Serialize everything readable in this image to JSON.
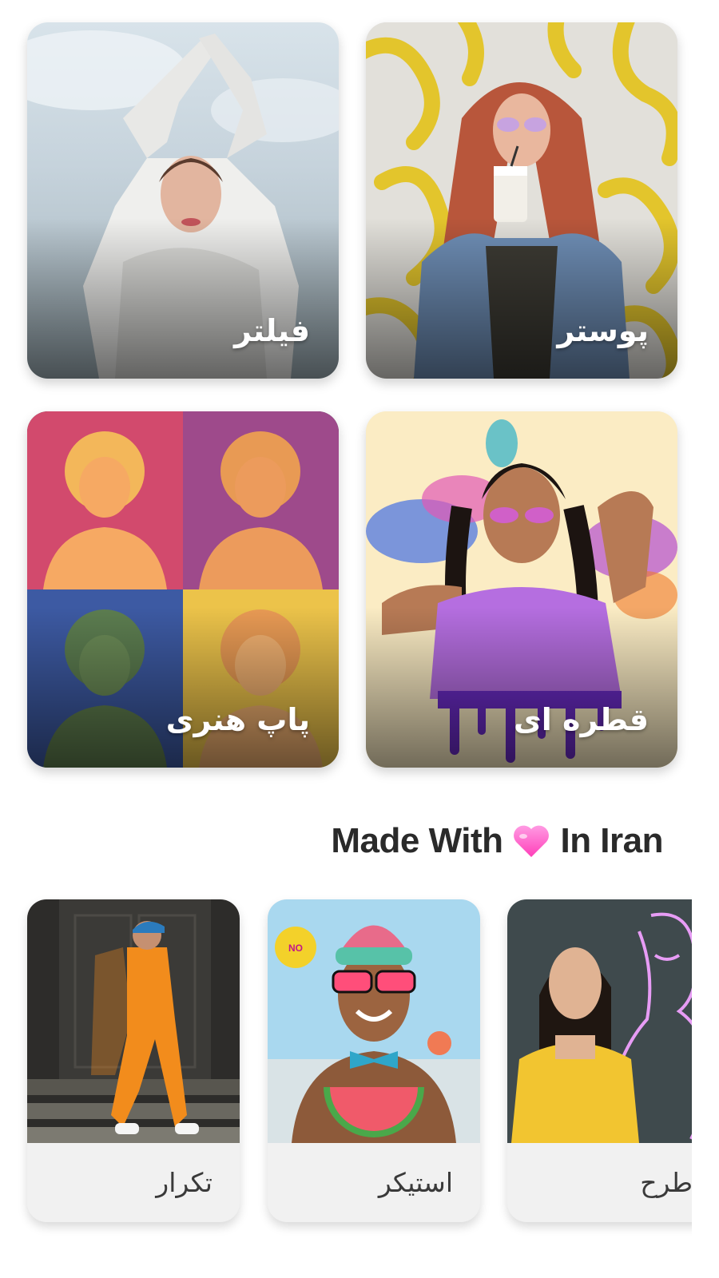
{
  "feature_cards": [
    {
      "label": "فیلتر"
    },
    {
      "label": "پوستر"
    },
    {
      "label": "پاپ هنری"
    },
    {
      "label": "قطره ای"
    }
  ],
  "section": {
    "heading_before": "Made With",
    "heading_icon": "pink-heart-icon",
    "heading_after": "In Iran"
  },
  "carousel": [
    {
      "label": "تکرار"
    },
    {
      "label": "استیکر"
    },
    {
      "label": "طرح"
    }
  ],
  "colors": {
    "heart": "#ff5fc8",
    "heading_text": "#2a2a2a",
    "caption_bg": "#f1f1f1"
  }
}
